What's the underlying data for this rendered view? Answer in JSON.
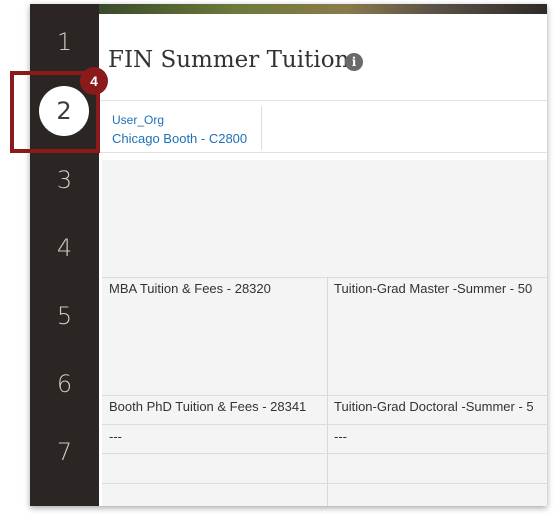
{
  "sidebar": {
    "steps": [
      "1",
      "2",
      "3",
      "4",
      "5",
      "6",
      "7"
    ],
    "active_step": "2"
  },
  "callout": {
    "number": "4",
    "color": "#8b1a1a"
  },
  "header": {
    "title": "FIN Summer Tuition",
    "info_icon_glyph": "i"
  },
  "prompt": {
    "label": "User_Org",
    "value": "Chicago Booth - C2800"
  },
  "table": {
    "rows": [
      {
        "col1": "MBA Tuition & Fees - 28320",
        "col2": "Tuition-Grad Master -Summer - 50"
      },
      {
        "col1": "Booth PhD Tuition & Fees - 28341",
        "col2": "Tuition-Grad Doctoral -Summer - 5"
      },
      {
        "col1": "---",
        "col2": "---"
      }
    ]
  }
}
